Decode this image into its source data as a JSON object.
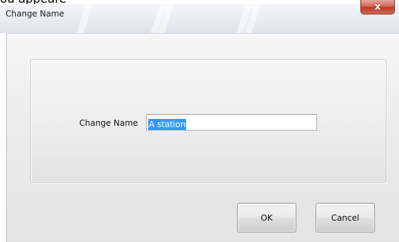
{
  "window": {
    "cropped_text": "ou appeare",
    "title": "Change Name",
    "close_glyph": "x"
  },
  "form": {
    "label": "Change Name",
    "input_value": "A station"
  },
  "buttons": {
    "ok_label": "OK",
    "cancel_label": "Cancel"
  },
  "icons": {
    "close": "close-icon"
  }
}
